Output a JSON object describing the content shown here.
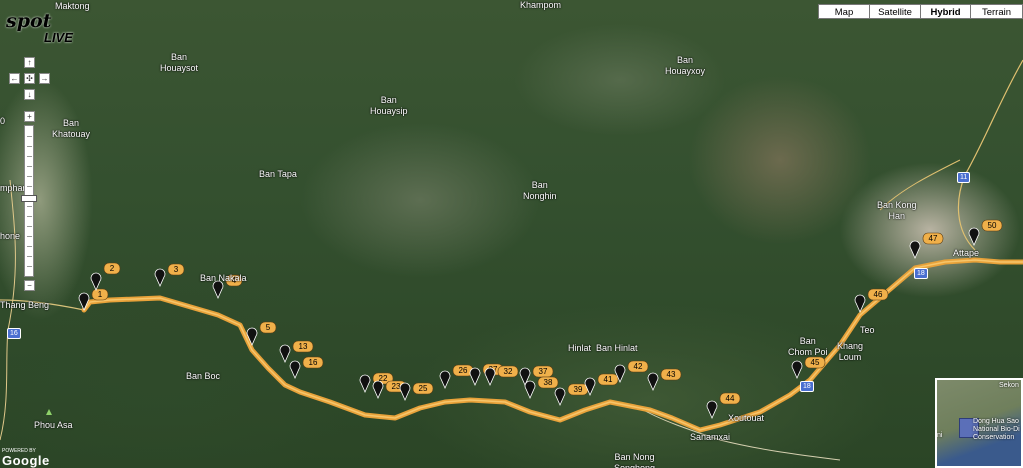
{
  "map_type_buttons": [
    {
      "label": "Map",
      "selected": false
    },
    {
      "label": "Satellite",
      "selected": false
    },
    {
      "label": "Hybrid",
      "selected": true
    },
    {
      "label": "Terrain",
      "selected": false
    }
  ],
  "logo": {
    "part1": "spot",
    "part2": "LIVE"
  },
  "controls": {
    "up": "↑",
    "left": "←",
    "center": "✣",
    "right": "→",
    "down": "↓",
    "zoom_in": "+",
    "zoom_out": "−"
  },
  "places": [
    {
      "id": "maktong",
      "text": "Maktong"
    },
    {
      "id": "khampom",
      "text": "Khampom"
    },
    {
      "id": "ban-houaysot",
      "text": "Ban\nHouaysot"
    },
    {
      "id": "ban-houayxoy",
      "text": "Ban\nHouayxoy"
    },
    {
      "id": "ban-houaysip",
      "text": "Ban\nHouaysip"
    },
    {
      "id": "ban-khatouay",
      "text": "Ban\nKhatouay"
    },
    {
      "id": "ban-tapa",
      "text": "Ban Tapa"
    },
    {
      "id": "ban-nonghin",
      "text": "Ban\nNonghin"
    },
    {
      "id": "ban-kong-han",
      "text": "Ban Kong\nHan"
    },
    {
      "id": "ban-nakala",
      "text": "Ban Nakala"
    },
    {
      "id": "hinlat",
      "text": "Hinlat"
    },
    {
      "id": "ban-hinlat",
      "text": "Ban Hinlat"
    },
    {
      "id": "ban-chom-poi",
      "text": "Ban\nChom Poi"
    },
    {
      "id": "teo",
      "text": "Teo"
    },
    {
      "id": "khang-loum",
      "text": "Khang\nLoum"
    },
    {
      "id": "ban-boc",
      "text": "Ban Boc"
    },
    {
      "id": "phou-asa",
      "text": "Phou Asa"
    },
    {
      "id": "sanamxai",
      "text": "Sanamxai"
    },
    {
      "id": "xoutouat",
      "text": "Xoutouat"
    },
    {
      "id": "ban-nong-songhong",
      "text": "Ban Nong\nSonghong"
    },
    {
      "id": "attapeu",
      "text": "Attape"
    },
    {
      "id": "thang-beng",
      "text": "Thang Beng"
    },
    {
      "id": "mphan",
      "text": "mphan"
    },
    {
      "id": "hone",
      "text": "hone"
    },
    {
      "id": "zero",
      "text": "0"
    }
  ],
  "road_shields": [
    {
      "id": "shield-16",
      "text": "16"
    },
    {
      "id": "shield-11",
      "text": "11"
    },
    {
      "id": "shield-18",
      "text": "18"
    },
    {
      "id": "shield-18b",
      "text": "18"
    }
  ],
  "track_markers": [
    "1",
    "2",
    "3",
    "4",
    "5",
    "13",
    "16",
    "22",
    "23",
    "25",
    "26",
    "27",
    "32",
    "37",
    "38",
    "39",
    "41",
    "42",
    "43",
    "44",
    "45",
    "46",
    "47",
    "50"
  ],
  "overview_map": {
    "city": "Sekon",
    "label": "Dong Hua Sao\nNational Bio-Di\nConservation",
    "edge": "ni"
  },
  "footer": {
    "powered_by": "POWERED BY",
    "google": "Google"
  },
  "colors": {
    "route": "#e8a23a",
    "marker_bg": "#f0b04a",
    "marker_text": "#000",
    "pin": "#111"
  }
}
